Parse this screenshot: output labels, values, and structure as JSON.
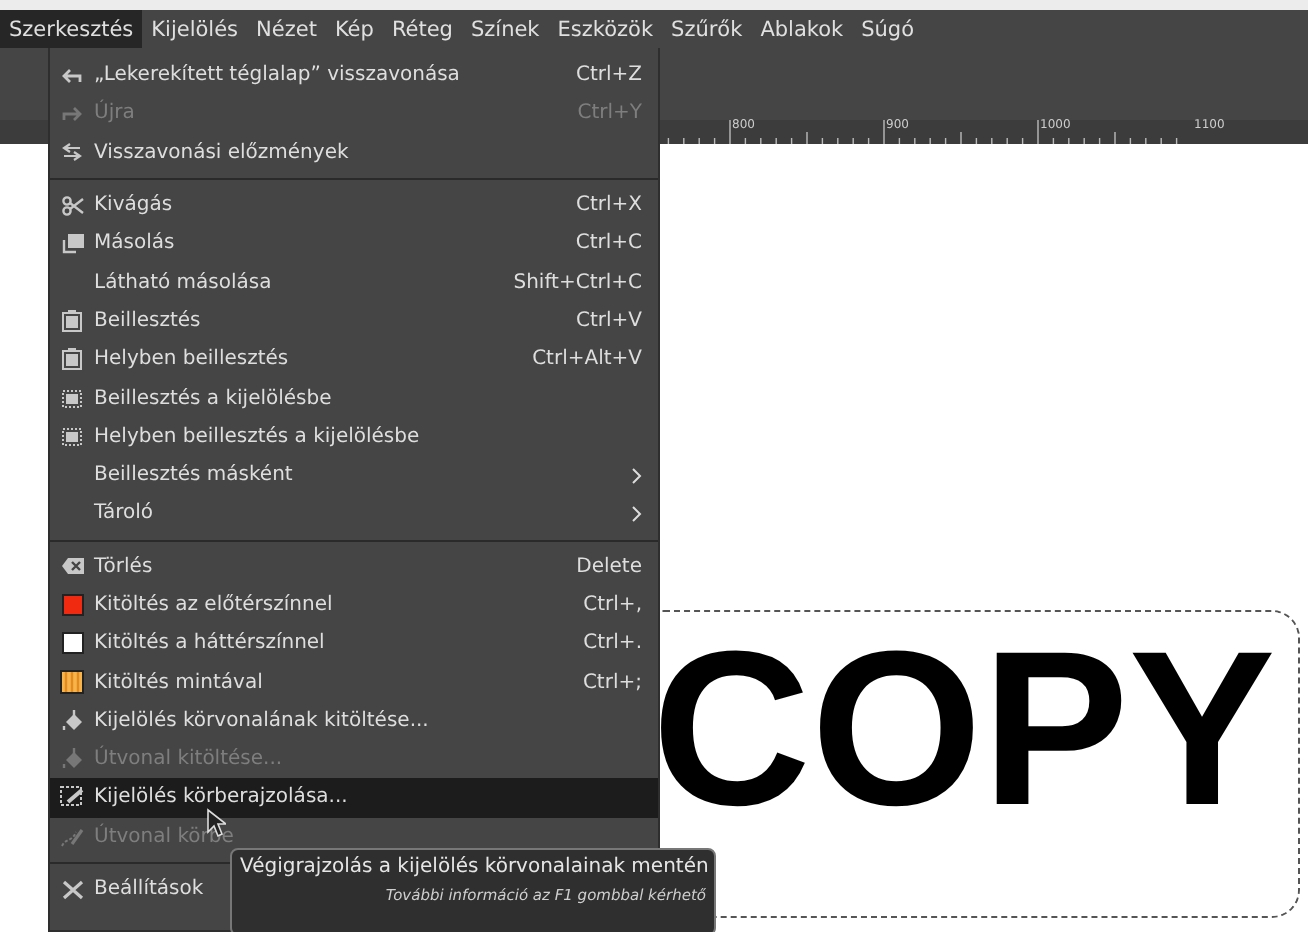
{
  "menubar": [
    {
      "label": "Szerkesztés",
      "selected": true
    },
    {
      "label": "Kijelölés",
      "selected": false
    },
    {
      "label": "Nézet",
      "selected": false
    },
    {
      "label": "Kép",
      "selected": false
    },
    {
      "label": "Réteg",
      "selected": false
    },
    {
      "label": "Színek",
      "selected": false
    },
    {
      "label": "Eszközök",
      "selected": false
    },
    {
      "label": "Szűrők",
      "selected": false
    },
    {
      "label": "Ablakok",
      "selected": false
    },
    {
      "label": "Súgó",
      "selected": false
    }
  ],
  "ruler": {
    "labels": [
      "800",
      "900",
      "1000",
      "1100"
    ]
  },
  "canvas": {
    "text": "COPY"
  },
  "menu": {
    "items": [
      {
        "kind": "item",
        "label": "„Lekerekített téglalap” visszavonása",
        "shortcut": "Ctrl+Z",
        "disabled": false,
        "selected": false
      },
      {
        "kind": "item",
        "label": "Újra",
        "shortcut": "Ctrl+Y",
        "disabled": true,
        "selected": false
      },
      {
        "kind": "item",
        "label": "Visszavonási előzmények",
        "disabled": false,
        "selected": false
      },
      {
        "kind": "separator"
      },
      {
        "kind": "item",
        "label": "Kivágás",
        "shortcut": "Ctrl+X",
        "disabled": false,
        "selected": false
      },
      {
        "kind": "item",
        "label": "Másolás",
        "shortcut": "Ctrl+C",
        "disabled": false,
        "selected": false
      },
      {
        "kind": "item",
        "label": "Látható másolása",
        "shortcut": "Shift+Ctrl+C",
        "disabled": false,
        "selected": false
      },
      {
        "kind": "item",
        "label": "Beillesztés",
        "shortcut": "Ctrl+V",
        "disabled": false,
        "selected": false
      },
      {
        "kind": "item",
        "label": "Helyben beillesztés",
        "shortcut": "Ctrl+Alt+V",
        "disabled": false,
        "selected": false
      },
      {
        "kind": "item",
        "label": "Beillesztés a kijelölésbe",
        "disabled": false,
        "selected": false
      },
      {
        "kind": "item",
        "label": "Helyben beillesztés a kijelölésbe",
        "disabled": false,
        "selected": false
      },
      {
        "kind": "item",
        "label": "Beillesztés másként",
        "submenu": true,
        "disabled": false,
        "selected": false
      },
      {
        "kind": "item",
        "label": "Tároló",
        "submenu": true,
        "disabled": false,
        "selected": false
      },
      {
        "kind": "separator"
      },
      {
        "kind": "item",
        "label": "Törlés",
        "shortcut": "Delete",
        "disabled": false,
        "selected": false
      },
      {
        "kind": "item",
        "color": "#f02a10",
        "label": "Kitöltés az előtérszínnel",
        "shortcut": "Ctrl+,",
        "disabled": false,
        "selected": false
      },
      {
        "kind": "item",
        "color": "#ffffff",
        "label": "Kitöltés a háttérszínnel",
        "shortcut": "Ctrl+.",
        "disabled": false,
        "selected": false
      },
      {
        "kind": "item",
        "label": "Kitöltés mintával",
        "shortcut": "Ctrl+;",
        "disabled": false,
        "selected": false
      },
      {
        "kind": "item",
        "label": "Kijelölés körvonalának kitöltése...",
        "disabled": false,
        "selected": false
      },
      {
        "kind": "item",
        "label": "Útvonal kitöltése...",
        "disabled": true,
        "selected": false
      },
      {
        "kind": "item",
        "label": "Kijelölés körberajzolása...",
        "disabled": false,
        "selected": true
      },
      {
        "kind": "item",
        "label": "Útvonal körbe",
        "disabled": true,
        "selected": false
      },
      {
        "kind": "separator"
      },
      {
        "kind": "item",
        "label": "Beállítások",
        "disabled": false,
        "selected": false
      }
    ]
  },
  "tooltip": {
    "text": "Végigrajzolás a kijelölés körvonalainak mentén",
    "hint": "További információ az F1 gombbal kérhető"
  }
}
